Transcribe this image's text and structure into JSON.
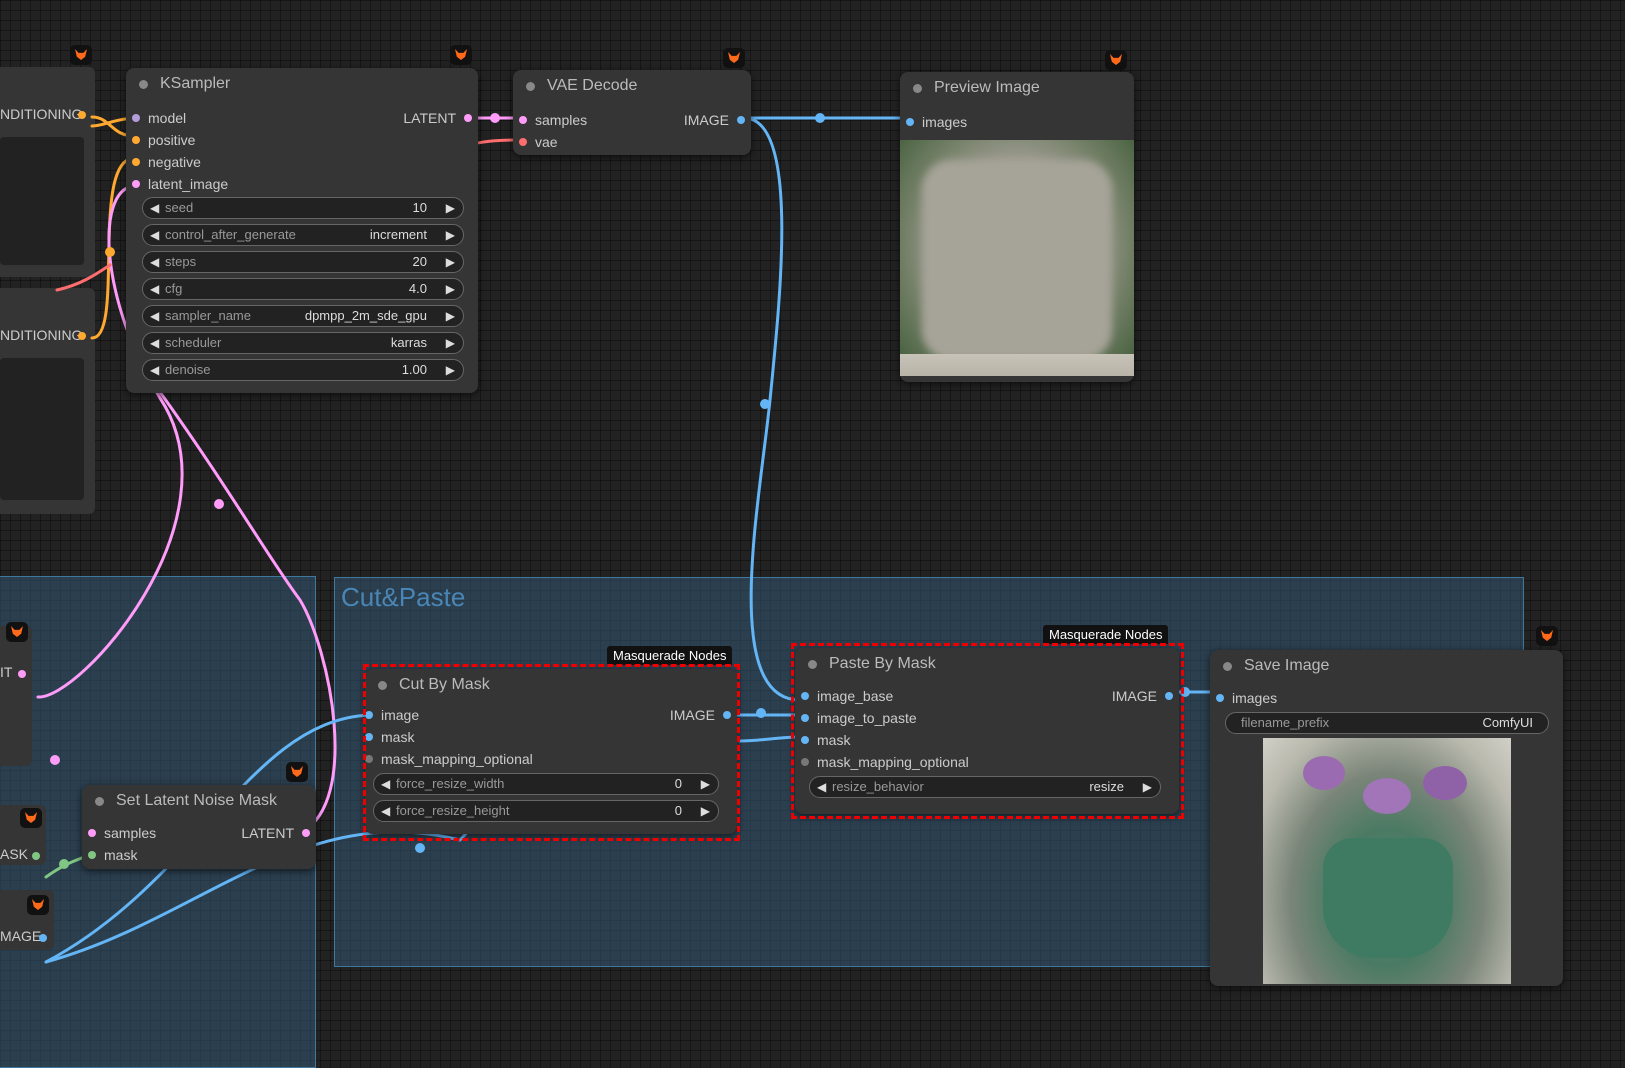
{
  "groups": [
    {
      "title": "Cut&Paste"
    }
  ],
  "fragments": {
    "cond1_out": "NDITIONING",
    "cond2_out": "NDITIONING",
    "lat_out": "IT",
    "mask_out": "ASK",
    "img_out": "MAGE"
  },
  "tags": {
    "masquerade": "Masquerade Nodes"
  },
  "ksampler": {
    "title": "KSampler",
    "inputs": [
      "model",
      "positive",
      "negative",
      "latent_image"
    ],
    "output": "LATENT",
    "widgets": [
      {
        "label": "seed",
        "value": "10"
      },
      {
        "label": "control_after_generate",
        "value": "increment"
      },
      {
        "label": "steps",
        "value": "20"
      },
      {
        "label": "cfg",
        "value": "4.0"
      },
      {
        "label": "sampler_name",
        "value": "dpmpp_2m_sde_gpu"
      },
      {
        "label": "scheduler",
        "value": "karras"
      },
      {
        "label": "denoise",
        "value": "1.00"
      }
    ]
  },
  "vae_decode": {
    "title": "VAE Decode",
    "inputs": [
      "samples",
      "vae"
    ],
    "output": "IMAGE"
  },
  "preview_image": {
    "title": "Preview Image",
    "inputs": [
      "images"
    ]
  },
  "cut_by_mask": {
    "title": "Cut By Mask",
    "inputs": [
      "image",
      "mask",
      "mask_mapping_optional"
    ],
    "output": "IMAGE",
    "widgets": [
      {
        "label": "force_resize_width",
        "value": "0"
      },
      {
        "label": "force_resize_height",
        "value": "0"
      }
    ]
  },
  "paste_by_mask": {
    "title": "Paste By Mask",
    "inputs": [
      "image_base",
      "image_to_paste",
      "mask",
      "mask_mapping_optional"
    ],
    "output": "IMAGE",
    "widgets": [
      {
        "label": "resize_behavior",
        "value": "resize"
      }
    ]
  },
  "save_image": {
    "title": "Save Image",
    "inputs": [
      "images"
    ],
    "widgets": [
      {
        "label": "filename_prefix",
        "value": "ComfyUI"
      }
    ]
  },
  "set_latent_noise_mask": {
    "title": "Set Latent Noise Mask",
    "inputs": [
      "samples",
      "mask"
    ],
    "output": "LATENT"
  },
  "arrows": {
    "left": "◀",
    "right": "▶"
  }
}
